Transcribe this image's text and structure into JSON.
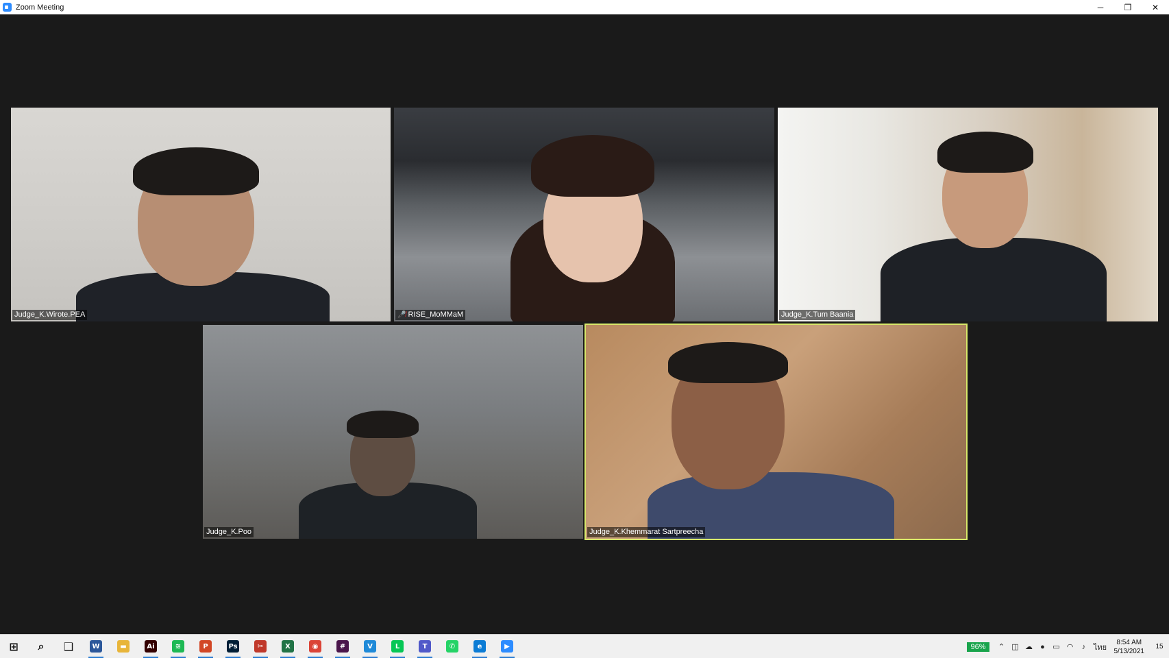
{
  "window": {
    "title": "Zoom Meeting",
    "minimize": "─",
    "maximize": "❐",
    "close": "✕"
  },
  "participants": [
    {
      "name": "Judge_K.Wirote.PEA",
      "muted": false,
      "active_speaker": false
    },
    {
      "name": "RISE_MoMMaM",
      "muted": true,
      "active_speaker": false
    },
    {
      "name": "Judge_K.Tum Baania",
      "muted": false,
      "active_speaker": false
    },
    {
      "name": "Judge_K.Poo",
      "muted": false,
      "active_speaker": false
    },
    {
      "name": "Judge_K.Khemmarat Sartpreecha",
      "muted": false,
      "active_speaker": true
    }
  ],
  "colors": {
    "active_speaker_border": "#d8e86a",
    "mute_icon": "#e02828",
    "meeting_bg": "#1a1a1a",
    "battery": "#19a44c"
  },
  "taskbar": {
    "apps": [
      {
        "icon": "windows-start-icon",
        "glyph": "⊞",
        "color": "#111111"
      },
      {
        "icon": "search-icon",
        "glyph": "⌕",
        "color": "#111111"
      },
      {
        "icon": "task-view-icon",
        "glyph": "❑",
        "color": "#111111"
      },
      {
        "icon": "word-icon",
        "glyph": "W",
        "color": "#2b579a"
      },
      {
        "icon": "file-explorer-icon",
        "glyph": "▬",
        "color": "#e8b53a"
      },
      {
        "icon": "illustrator-icon",
        "glyph": "Ai",
        "color": "#330000"
      },
      {
        "icon": "spotify-icon",
        "glyph": "≋",
        "color": "#1db954"
      },
      {
        "icon": "powerpoint-icon",
        "glyph": "P",
        "color": "#d24726"
      },
      {
        "icon": "photoshop-icon",
        "glyph": "Ps",
        "color": "#001e36"
      },
      {
        "icon": "snipping-tool-icon",
        "glyph": "✂",
        "color": "#c0392b"
      },
      {
        "icon": "excel-icon",
        "glyph": "X",
        "color": "#217346"
      },
      {
        "icon": "chrome-icon",
        "glyph": "◉",
        "color": "#db4437"
      },
      {
        "icon": "slack-icon",
        "glyph": "#",
        "color": "#4a154b"
      },
      {
        "icon": "vs-icon",
        "glyph": "V",
        "color": "#1f8ad8"
      },
      {
        "icon": "line-icon",
        "glyph": "L",
        "color": "#06c755"
      },
      {
        "icon": "teams-icon",
        "glyph": "T",
        "color": "#5059c9"
      },
      {
        "icon": "whatsapp-icon",
        "glyph": "✆",
        "color": "#25d366"
      },
      {
        "icon": "edge-icon",
        "glyph": "e",
        "color": "#0c7cd5"
      },
      {
        "icon": "zoom-icon",
        "glyph": "▶",
        "color": "#2d8cff"
      }
    ],
    "tray": {
      "battery": "96%",
      "language": "ไทย",
      "time": "8:54 AM",
      "date": "5/13/2021",
      "notifications": "15"
    }
  }
}
